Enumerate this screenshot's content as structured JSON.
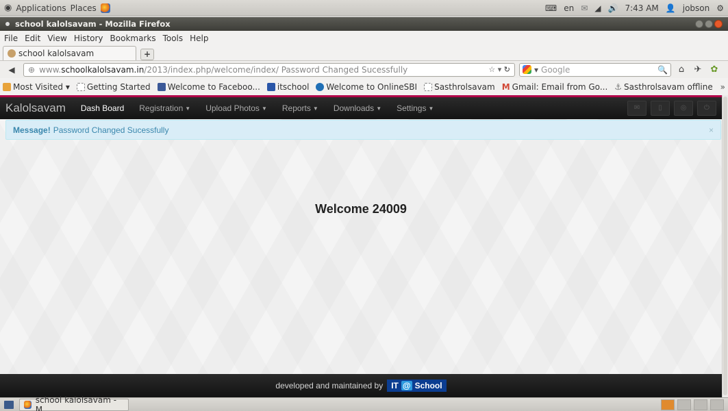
{
  "system_panel": {
    "applications": "Applications",
    "places": "Places",
    "keyboard": "en",
    "time": "7:43 AM",
    "user": "jobson"
  },
  "window": {
    "title": "school kalolsavam - Mozilla Firefox"
  },
  "menu": [
    "File",
    "Edit",
    "View",
    "History",
    "Bookmarks",
    "Tools",
    "Help"
  ],
  "tab": {
    "label": "school kalolsavam",
    "new_tab": "+"
  },
  "navbar": {
    "url_prefix": "www.",
    "url_host": "schoolkalolsavam.in",
    "url_path": "/2013/index.php/welcome/index/ Password Changed Sucessfully",
    "search_placeholder": "Google"
  },
  "bookmarks": [
    {
      "label": "Most Visited ▾",
      "color": "#e8a33b"
    },
    {
      "label": "Getting Started",
      "color": "#ffffff"
    },
    {
      "label": "Welcome to Faceboo...",
      "color": "#3b5998"
    },
    {
      "label": "itschool",
      "color": "#2a56a8"
    },
    {
      "label": "Welcome to OnlineSBI",
      "color": "#1f6fb5"
    },
    {
      "label": "Sasthrolsavam",
      "color": "#ffffff"
    },
    {
      "label": "Gmail: Email from Go...",
      "color": "#d14836"
    },
    {
      "label": "Sasthrolsavam offline",
      "color": "#777777"
    }
  ],
  "site": {
    "brand": "Kalolsavam",
    "nav": [
      {
        "label": "Dash Board",
        "active": true,
        "caret": false
      },
      {
        "label": "Registration",
        "active": false,
        "caret": true
      },
      {
        "label": "Upload Photos",
        "active": false,
        "caret": true
      },
      {
        "label": "Reports",
        "active": false,
        "caret": true
      },
      {
        "label": "Downloads",
        "active": false,
        "caret": true
      },
      {
        "label": "Settings",
        "active": false,
        "caret": true
      }
    ],
    "alert_strong": "Message!",
    "alert_text": "Password Changed Sucessfully",
    "alert_close": "×",
    "welcome": "Welcome 24009",
    "footer_text": "developed and maintained by",
    "footer_logo_it": "IT",
    "footer_logo_at": "@",
    "footer_logo_school": "School"
  },
  "taskbar": {
    "task_label": "school kalolsavam - M..."
  },
  "colors": {
    "accent": "#b00048",
    "alert_bg": "#d9edf7",
    "alert_text": "#3a87ad"
  }
}
